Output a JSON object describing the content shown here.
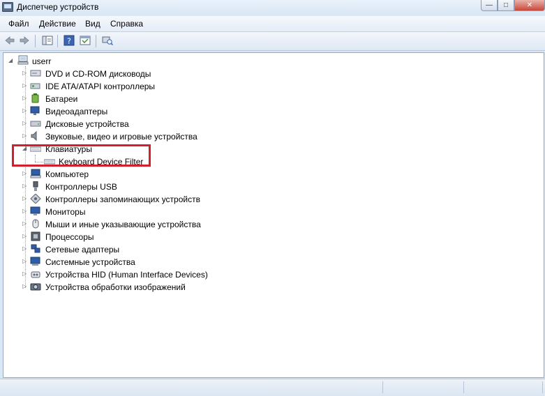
{
  "window": {
    "title": "Диспетчер устройств"
  },
  "menu": {
    "items": [
      "Файл",
      "Действие",
      "Вид",
      "Справка"
    ]
  },
  "toolbar": {
    "buttons": [
      "back-icon",
      "forward-icon",
      "show-hide-tree-icon",
      "help-icon",
      "properties-icon",
      "scan-hardware-icon"
    ]
  },
  "tree": {
    "root": "userr",
    "categories": [
      {
        "label": "DVD и CD-ROM дисководы",
        "icon": "dvd-drive-icon",
        "expanded": false
      },
      {
        "label": "IDE ATA/ATAPI контроллеры",
        "icon": "ide-controller-icon",
        "expanded": false
      },
      {
        "label": "Батареи",
        "icon": "battery-icon",
        "expanded": false
      },
      {
        "label": "Видеоадаптеры",
        "icon": "display-adapter-icon",
        "expanded": false
      },
      {
        "label": "Дисковые устройства",
        "icon": "disk-drive-icon",
        "expanded": false
      },
      {
        "label": "Звуковые, видео и игровые устройства",
        "icon": "sound-icon",
        "expanded": false
      },
      {
        "label": "Клавиатуры",
        "icon": "keyboard-icon",
        "expanded": true,
        "children": [
          "Keyboard Device Filter"
        ]
      },
      {
        "label": "Компьютер",
        "icon": "computer-icon",
        "expanded": false
      },
      {
        "label": "Контроллеры USB",
        "icon": "usb-icon",
        "expanded": false
      },
      {
        "label": "Контроллеры запоминающих устройств",
        "icon": "storage-controller-icon",
        "expanded": false
      },
      {
        "label": "Мониторы",
        "icon": "monitor-icon",
        "expanded": false
      },
      {
        "label": "Мыши и иные указывающие устройства",
        "icon": "mouse-icon",
        "expanded": false
      },
      {
        "label": "Процессоры",
        "icon": "processor-icon",
        "expanded": false
      },
      {
        "label": "Сетевые адаптеры",
        "icon": "network-adapter-icon",
        "expanded": false
      },
      {
        "label": "Системные устройства",
        "icon": "system-devices-icon",
        "expanded": false
      },
      {
        "label": "Устройства HID (Human Interface Devices)",
        "icon": "hid-icon",
        "expanded": false
      },
      {
        "label": "Устройства обработки изображений",
        "icon": "imaging-devices-icon",
        "expanded": false
      }
    ]
  },
  "colors": {
    "highlight": "#d51e2c",
    "window_bg": "#dce7f4"
  }
}
